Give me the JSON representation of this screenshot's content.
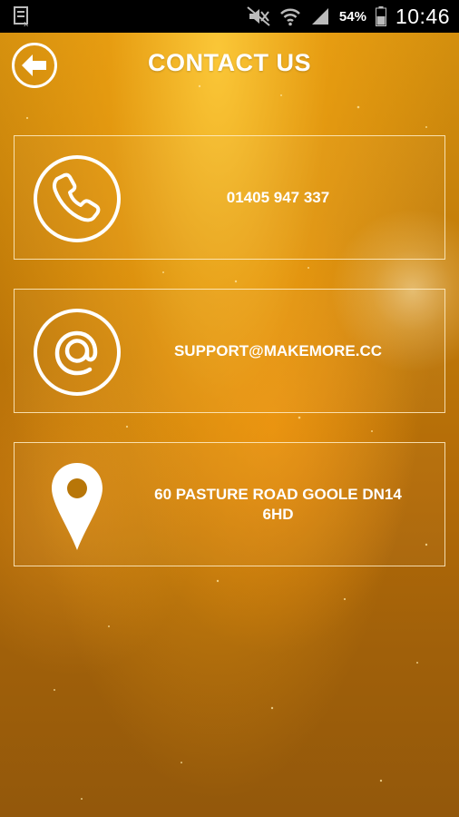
{
  "status_bar": {
    "battery_percent": "54%",
    "time": "10:46"
  },
  "header": {
    "title": "CONTACT US",
    "back_icon": "back-arrow-icon"
  },
  "contacts": [
    {
      "icon": "phone-icon",
      "value": "01405 947 337"
    },
    {
      "icon": "at-icon",
      "value": "SUPPORT@MAKEMORE.CC"
    },
    {
      "icon": "location-pin-icon",
      "value": "60 PASTURE ROAD GOOLE DN14 6HD"
    }
  ],
  "colors": {
    "background": "#c47e0a",
    "text": "#ffffff",
    "card_border": "#ffeec8"
  }
}
